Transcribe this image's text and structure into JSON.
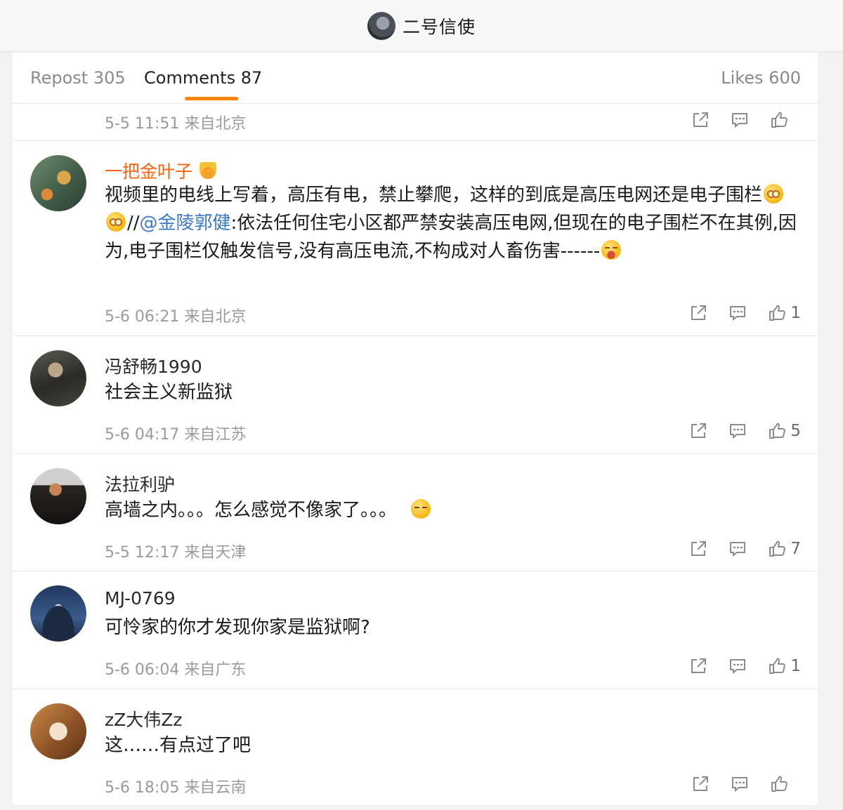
{
  "header": {
    "title": "二号信使"
  },
  "tabs": [
    {
      "label": "Repost 305"
    },
    {
      "label": "Comments 87"
    },
    {
      "label": "Likes 600"
    }
  ],
  "partial_comment": {
    "meta": "5-5 11:51 来自北京",
    "likes": ""
  },
  "comments": [
    {
      "user": "一把金叶子",
      "text_part1": "视频里的电线上写着，高压有电，禁止攀爬，这样的到底是高压电网还是电子围栏",
      "text_part2": "//",
      "mention": "@金陵郭健",
      "text_part3": ":依法任何住宅小区都严禁安装高压电网,但现在的电子围栏不在其例,因为,电子围栏仅触发信号,没有高压电流,不构成对人畜伤害------",
      "meta": "5-6 06:21 来自北京",
      "likes": "1"
    },
    {
      "user": "冯舒畅1990",
      "text": "社会主义新监狱",
      "meta": "5-6 04:17 来自江苏",
      "likes": "5"
    },
    {
      "user": "法拉利驴",
      "text": "高墙之内。。。怎么感觉不像家了。。。",
      "meta": "5-5 12:17 来自天津",
      "likes": "7"
    },
    {
      "user": "MJ-0769",
      "text": "可怜家的你才发现你家是监狱啊?",
      "meta": "5-6 06:04 来自广东",
      "likes": "1"
    },
    {
      "user": "zZ大伟Zz",
      "text": "这……有点过了吧",
      "meta": "5-6 18:05 来自云南",
      "likes": ""
    }
  ],
  "icons": {
    "repost": "share-out-icon",
    "comment": "comment-bubble-icon",
    "like": "thumbs-up-icon",
    "verified": "crown-badge-icon"
  },
  "colors": {
    "accent": "#ff8200",
    "vip_name": "#f86211",
    "mention": "#3c78c8",
    "meta": "#9a9a9a"
  }
}
